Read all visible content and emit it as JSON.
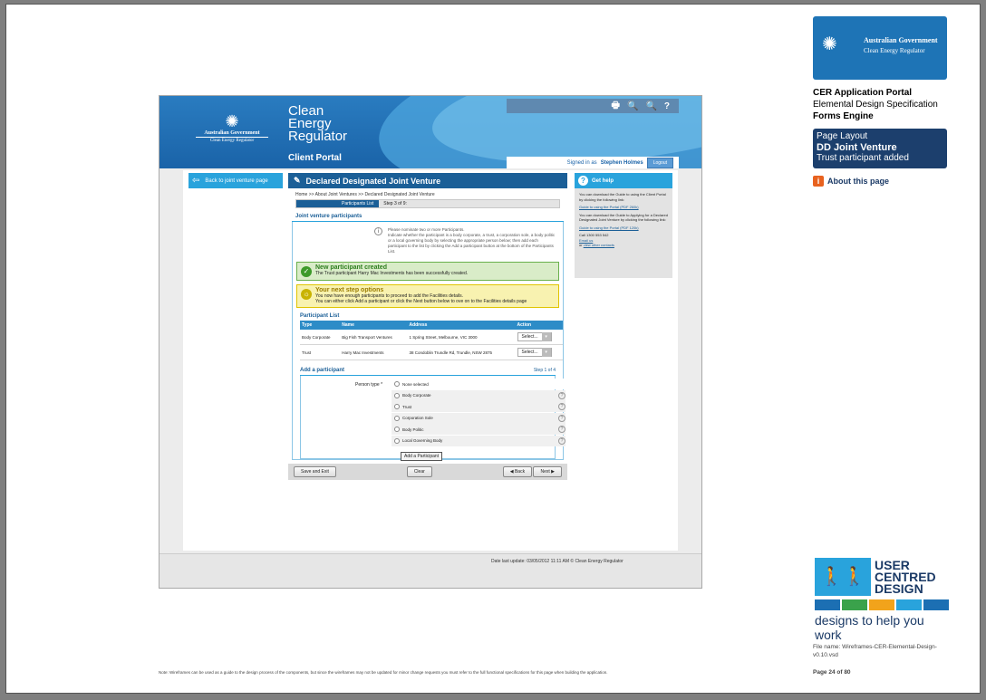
{
  "portal": {
    "tools": [
      "🖶",
      "🔍",
      "🔍",
      "?"
    ],
    "gov_logo_line1": "Australian Government",
    "gov_logo_line2": "Clean Energy Regulator",
    "title_line1": "Clean",
    "title_line2": "Energy",
    "title_line3": "Regulator",
    "subtitle": "Client Portal",
    "signed_in_prefix": "Signed in as",
    "user_name": "Stephen Holmes",
    "logout_label": "Logout"
  },
  "left_nav": {
    "back_label": "Back to joint venture page"
  },
  "main": {
    "heading": "Declared Designated Joint Venture",
    "breadcrumb": "Home >> About Joint Ventures >> Declared Designated Joint Venture",
    "step_tab": "Participants List",
    "step_count": "Step 3 of 9:",
    "section_title": "Joint venture participants",
    "info_line1": "Please nominate two or more Participants.",
    "info_line2": "Indicate whether the participant is a body corporate, a trust, a corporation sole, a body politic or a local governing body by selecting the appropriate person below; then add each participant to the list by clicking the Add a participant button at the bottom of the Participants List.",
    "success_title": "New participant created",
    "success_text": "The Trust participant Harry Mac Investments has been successfully created.",
    "next_title": "Your next step options",
    "next_line1": "You now have enough participants to proceed to add the Facilities details.",
    "next_line2": "You can either click Add a participant or click the Next button below to ove on to the Facilities details page"
  },
  "participant_list": {
    "title": "Participant List",
    "columns": [
      "Type",
      "Name",
      "Address",
      "Action"
    ],
    "rows": [
      {
        "type": "Body Corporate",
        "name": "Big Fish Transport Ventures",
        "address": "1 Spring Street, Melbourne, VIC 3000",
        "action": "Select..."
      },
      {
        "type": "Trust",
        "name": "Harry Mac Investments",
        "address": "38 Condoblin Trundle Rd, Trundle, NSW 2875",
        "action": "Select..."
      }
    ]
  },
  "add_participant": {
    "title": "Add a participant",
    "step": "Step 1 of 4",
    "person_type_label": "Person type *",
    "options": [
      "None selected",
      "Body Corporate",
      "Trust",
      "Corporation Sole",
      "Body Politic",
      "Local Governing Body"
    ],
    "button_label": "Add a Participant"
  },
  "nav_buttons": {
    "save_exit": "Save and Exit",
    "clear": "Clear",
    "back": "◀ Back",
    "next": "Next ▶"
  },
  "help": {
    "title": "Get help",
    "p1": "You can download the Guide to using the Client Portal by clicking the following link:",
    "link1": "Guide to using the Portal (PDF 260k)",
    "p2": "You can download the Guide to Applying for a Declared Designated Joint Venture by clicking the following link:",
    "link2": "Guide to using the Portal (PDF 120k)",
    "call": "Call 1300 553 542",
    "email": "Email us",
    "contacts_prefix": "or",
    "contacts_link": "view other contacts"
  },
  "footer": {
    "date_text": "Date last update: 03/05/2012 11:11 AM   © Clean Energy Regulator"
  },
  "sidebar": {
    "gov_line1": "Australian Government",
    "gov_line2": "Clean Energy Regulator",
    "doc_title": "CER Application Portal",
    "doc_subtitle": "Elemental Design Specification",
    "doc_engine": "Forms Engine",
    "layout_label": "Page Layout",
    "layout_name": "DD Joint Venture",
    "layout_state": "Trust participant added",
    "about_label": "About this page",
    "ucd_word1": "USER",
    "ucd_word2": "CENTRED",
    "ucd_word3": "DESIGN",
    "ucd_tagline": "designs to help you work",
    "file_name": "File name: Wireframes-CER-Elemental-Design-v0.10.vsd",
    "page_number": "Page 24 of 80",
    "ucd_colors": [
      "#1c6fb3",
      "#3aa24b",
      "#f2a31b",
      "#29a3dc",
      "#1c6fb3"
    ]
  },
  "footnote": "Note: Wireframes can be used as a guide to the design process of the components, but since the wireframes may not be updated for minor change requests you must refer to the full functional specifications for this page when building the application."
}
